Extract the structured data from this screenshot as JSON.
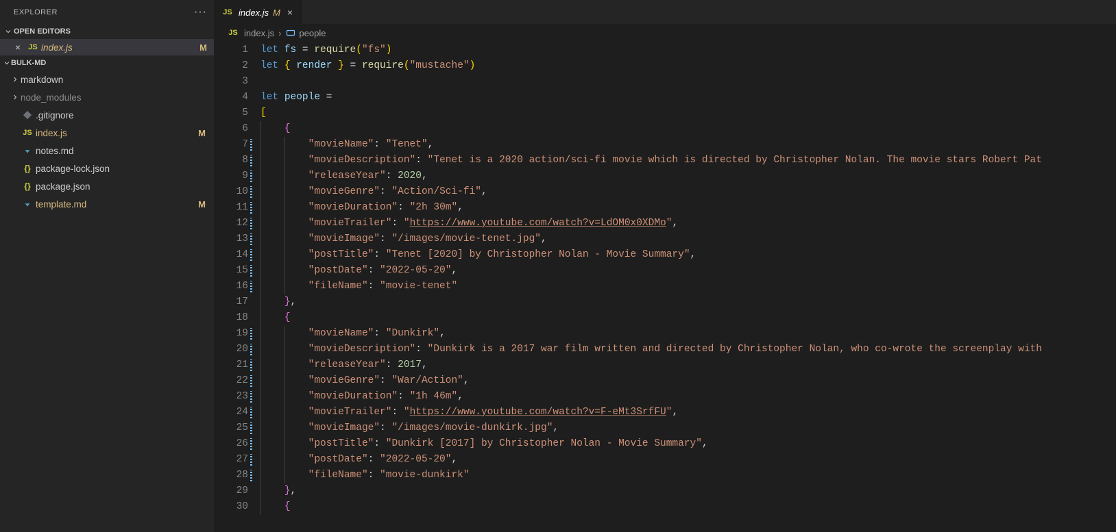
{
  "sidebar": {
    "title": "EXPLORER",
    "sections": {
      "openEditors": {
        "label": "OPEN EDITORS",
        "items": [
          {
            "name": "index.js",
            "modified": "M"
          }
        ]
      },
      "project": {
        "label": "BULK-MD",
        "items": [
          {
            "name": "markdown",
            "type": "folder"
          },
          {
            "name": "node_modules",
            "type": "folder",
            "muted": true
          },
          {
            "name": ".gitignore",
            "type": "git"
          },
          {
            "name": "index.js",
            "type": "js",
            "modified": "M"
          },
          {
            "name": "notes.md",
            "type": "md"
          },
          {
            "name": "package-lock.json",
            "type": "json"
          },
          {
            "name": "package.json",
            "type": "json"
          },
          {
            "name": "template.md",
            "type": "md",
            "modified": "M"
          }
        ]
      }
    }
  },
  "tab": {
    "name": "index.js",
    "modified": "M"
  },
  "breadcrumb": {
    "file": "index.js",
    "symbol": "people"
  },
  "code": {
    "lines": [
      {
        "n": 1,
        "t": [
          [
            "kw",
            "let"
          ],
          [
            "op",
            " "
          ],
          [
            "var",
            "fs"
          ],
          [
            "op",
            " = "
          ],
          [
            "fn",
            "require"
          ],
          [
            "brace",
            "("
          ],
          [
            "str",
            "\"fs\""
          ],
          [
            "brace",
            ")"
          ]
        ]
      },
      {
        "n": 2,
        "t": [
          [
            "kw",
            "let"
          ],
          [
            "op",
            " "
          ],
          [
            "brace",
            "{"
          ],
          [
            "op",
            " "
          ],
          [
            "var",
            "render"
          ],
          [
            "op",
            " "
          ],
          [
            "brace",
            "}"
          ],
          [
            "op",
            " = "
          ],
          [
            "fn",
            "require"
          ],
          [
            "brace",
            "("
          ],
          [
            "str",
            "\"mustache\""
          ],
          [
            "brace",
            ")"
          ]
        ]
      },
      {
        "n": 3,
        "t": []
      },
      {
        "n": 4,
        "t": [
          [
            "kw",
            "let"
          ],
          [
            "op",
            " "
          ],
          [
            "var",
            "people"
          ],
          [
            "op",
            " ="
          ]
        ]
      },
      {
        "n": 5,
        "t": [
          [
            "brace",
            "["
          ]
        ]
      },
      {
        "n": 6,
        "indent": 1,
        "t": [
          [
            "brace2",
            "{"
          ]
        ]
      },
      {
        "n": 7,
        "indent": 2,
        "decor": true,
        "t": [
          [
            "str",
            "\"movieName\""
          ],
          [
            "op",
            ": "
          ],
          [
            "str",
            "\"Tenet\""
          ],
          [
            "op",
            ","
          ]
        ]
      },
      {
        "n": 8,
        "indent": 2,
        "decor": true,
        "t": [
          [
            "str",
            "\"movieDescription\""
          ],
          [
            "op",
            ": "
          ],
          [
            "str",
            "\"Tenet is a 2020 action/sci-fi movie which is directed by Christopher Nolan. The movie stars Robert Pat"
          ]
        ]
      },
      {
        "n": 9,
        "indent": 2,
        "decor": true,
        "t": [
          [
            "str",
            "\"releaseYear\""
          ],
          [
            "op",
            ": "
          ],
          [
            "num",
            "2020"
          ],
          [
            "op",
            ","
          ]
        ]
      },
      {
        "n": 10,
        "indent": 2,
        "decor": true,
        "t": [
          [
            "str",
            "\"movieGenre\""
          ],
          [
            "op",
            ": "
          ],
          [
            "str",
            "\"Action/Sci-fi\""
          ],
          [
            "op",
            ","
          ]
        ]
      },
      {
        "n": 11,
        "indent": 2,
        "decor": true,
        "t": [
          [
            "str",
            "\"movieDuration\""
          ],
          [
            "op",
            ": "
          ],
          [
            "str",
            "\"2h 30m\""
          ],
          [
            "op",
            ","
          ]
        ]
      },
      {
        "n": 12,
        "indent": 2,
        "decor": true,
        "t": [
          [
            "str",
            "\"movieTrailer\""
          ],
          [
            "op",
            ": "
          ],
          [
            "str",
            "\""
          ],
          [
            "link",
            "https://www.youtube.com/watch?v=LdOM0x0XDMo"
          ],
          [
            "str",
            "\""
          ],
          [
            "op",
            ","
          ]
        ]
      },
      {
        "n": 13,
        "indent": 2,
        "decor": true,
        "t": [
          [
            "str",
            "\"movieImage\""
          ],
          [
            "op",
            ": "
          ],
          [
            "str",
            "\"/images/movie-tenet.jpg\""
          ],
          [
            "op",
            ","
          ]
        ]
      },
      {
        "n": 14,
        "indent": 2,
        "decor": true,
        "t": [
          [
            "str",
            "\"postTitle\""
          ],
          [
            "op",
            ": "
          ],
          [
            "str",
            "\"Tenet [2020] by Christopher Nolan - Movie Summary\""
          ],
          [
            "op",
            ","
          ]
        ]
      },
      {
        "n": 15,
        "indent": 2,
        "decor": true,
        "t": [
          [
            "str",
            "\"postDate\""
          ],
          [
            "op",
            ": "
          ],
          [
            "str",
            "\"2022-05-20\""
          ],
          [
            "op",
            ","
          ]
        ]
      },
      {
        "n": 16,
        "indent": 2,
        "decor": true,
        "t": [
          [
            "str",
            "\"fileName\""
          ],
          [
            "op",
            ": "
          ],
          [
            "str",
            "\"movie-tenet\""
          ]
        ]
      },
      {
        "n": 17,
        "indent": 1,
        "t": [
          [
            "brace2",
            "}"
          ],
          [
            "op",
            ","
          ]
        ]
      },
      {
        "n": 18,
        "indent": 1,
        "t": [
          [
            "brace2",
            "{"
          ]
        ]
      },
      {
        "n": 19,
        "indent": 2,
        "decor": true,
        "t": [
          [
            "str",
            "\"movieName\""
          ],
          [
            "op",
            ": "
          ],
          [
            "str",
            "\"Dunkirk\""
          ],
          [
            "op",
            ","
          ]
        ]
      },
      {
        "n": 20,
        "indent": 2,
        "decor": true,
        "t": [
          [
            "str",
            "\"movieDescription\""
          ],
          [
            "op",
            ": "
          ],
          [
            "str",
            "\"Dunkirk is a 2017 war film written and directed by Christopher Nolan, who co-wrote the screenplay with"
          ]
        ]
      },
      {
        "n": 21,
        "indent": 2,
        "decor": true,
        "t": [
          [
            "str",
            "\"releaseYear\""
          ],
          [
            "op",
            ": "
          ],
          [
            "num",
            "2017"
          ],
          [
            "op",
            ","
          ]
        ]
      },
      {
        "n": 22,
        "indent": 2,
        "decor": true,
        "t": [
          [
            "str",
            "\"movieGenre\""
          ],
          [
            "op",
            ": "
          ],
          [
            "str",
            "\"War/Action\""
          ],
          [
            "op",
            ","
          ]
        ]
      },
      {
        "n": 23,
        "indent": 2,
        "decor": true,
        "t": [
          [
            "str",
            "\"movieDuration\""
          ],
          [
            "op",
            ": "
          ],
          [
            "str",
            "\"1h 46m\""
          ],
          [
            "op",
            ","
          ]
        ]
      },
      {
        "n": 24,
        "indent": 2,
        "decor": true,
        "t": [
          [
            "str",
            "\"movieTrailer\""
          ],
          [
            "op",
            ": "
          ],
          [
            "str",
            "\""
          ],
          [
            "link",
            "https://www.youtube.com/watch?v=F-eMt3SrfFU"
          ],
          [
            "str",
            "\""
          ],
          [
            "op",
            ","
          ]
        ]
      },
      {
        "n": 25,
        "indent": 2,
        "decor": true,
        "t": [
          [
            "str",
            "\"movieImage\""
          ],
          [
            "op",
            ": "
          ],
          [
            "str",
            "\"/images/movie-dunkirk.jpg\""
          ],
          [
            "op",
            ","
          ]
        ]
      },
      {
        "n": 26,
        "indent": 2,
        "decor": true,
        "t": [
          [
            "str",
            "\"postTitle\""
          ],
          [
            "op",
            ": "
          ],
          [
            "str",
            "\"Dunkirk [2017] by Christopher Nolan - Movie Summary\""
          ],
          [
            "op",
            ","
          ]
        ]
      },
      {
        "n": 27,
        "indent": 2,
        "decor": true,
        "t": [
          [
            "str",
            "\"postDate\""
          ],
          [
            "op",
            ": "
          ],
          [
            "str",
            "\"2022-05-20\""
          ],
          [
            "op",
            ","
          ]
        ]
      },
      {
        "n": 28,
        "indent": 2,
        "decor": true,
        "t": [
          [
            "str",
            "\"fileName\""
          ],
          [
            "op",
            ": "
          ],
          [
            "str",
            "\"movie-dunkirk\""
          ]
        ]
      },
      {
        "n": 29,
        "indent": 1,
        "t": [
          [
            "brace2",
            "}"
          ],
          [
            "op",
            ","
          ]
        ]
      },
      {
        "n": 30,
        "indent": 1,
        "t": [
          [
            "brace2",
            "{"
          ]
        ]
      }
    ]
  }
}
